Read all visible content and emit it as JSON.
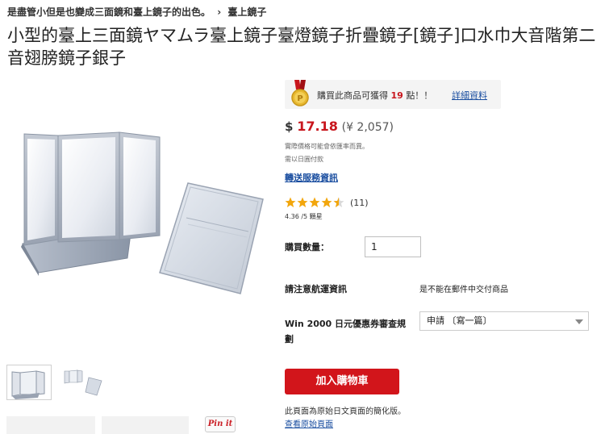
{
  "breadcrumb": {
    "category": "是盡管小但是也變成三面鏡和臺上鏡子的出色。",
    "separator": "›",
    "current": "臺上鏡子"
  },
  "product": {
    "title": "小型的臺上三面鏡ヤマムラ臺上鏡子臺燈鏡子折疊鏡子[鏡子]口水巾大音階第二音翅膀鏡子銀子"
  },
  "points": {
    "prefix": "購買此商品可獲得",
    "value": "19",
    "suffix": "點！！",
    "details_link": "詳細資料",
    "medal_color": "#c8161d",
    "coin_color": "#e8b830"
  },
  "price": {
    "currency_symbol": "$",
    "usd": "17.18",
    "yen": "(¥ 2,057)",
    "note_1": "實際價格可能會依匯率而異。",
    "note_2": "需以日圓付款"
  },
  "shipping": {
    "info_link": "轉送服務資訊"
  },
  "rating": {
    "stars": 4.5,
    "max": 5,
    "count_label": "(11)",
    "text": "4.36 /5 顆星",
    "star_color": "#f2a60c"
  },
  "quantity": {
    "label": "購買數量：",
    "value": "1"
  },
  "shipping_notice": {
    "label": "請注意航運資訊",
    "value": "是不能在郵件中交付商品"
  },
  "coupon": {
    "label": "Win 2000 日元優惠券審查規劃",
    "selected": "申請 〔寫一篇〕"
  },
  "cart": {
    "button_label": "加入購物車",
    "color": "#d2151b"
  },
  "footer": {
    "simplified_note": "此頁面為原始日文頁面的簡化版。",
    "original_link": "查看原始頁面"
  },
  "social": {
    "pin_label": "Pin it"
  }
}
